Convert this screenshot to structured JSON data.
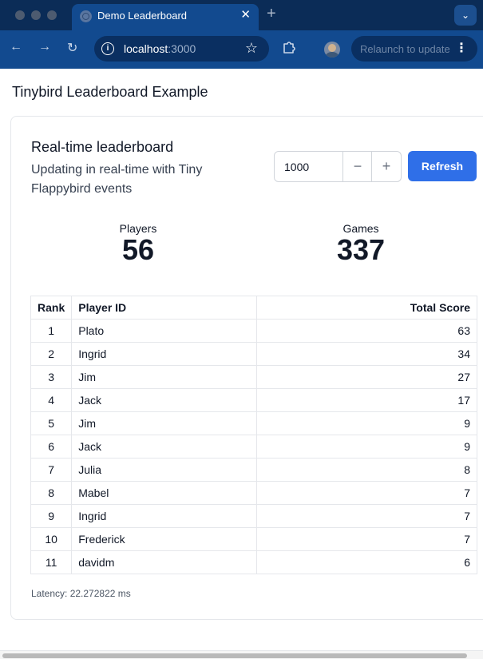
{
  "browser": {
    "tab_title": "Demo Leaderboard",
    "url_host": "localhost",
    "url_port": ":3000",
    "relaunch_label": "Relaunch to update"
  },
  "page": {
    "title": "Tinybird Leaderboard Example"
  },
  "card": {
    "title": "Real-time leaderboard",
    "subtitle": "Updating in real-time with Tiny Flappybird events",
    "limit_value": "1000",
    "decrement_label": "−",
    "increment_label": "+",
    "refresh_label": "Refresh"
  },
  "stats": {
    "players_label": "Players",
    "players_value": "56",
    "games_label": "Games",
    "games_value": "337"
  },
  "table": {
    "headers": {
      "rank": "Rank",
      "player": "Player ID",
      "score": "Total Score"
    },
    "rows": [
      {
        "rank": "1",
        "player": "Plato",
        "score": "63"
      },
      {
        "rank": "2",
        "player": "Ingrid",
        "score": "34"
      },
      {
        "rank": "3",
        "player": "Jim",
        "score": "27"
      },
      {
        "rank": "4",
        "player": "Jack",
        "score": "17"
      },
      {
        "rank": "5",
        "player": "Jim",
        "score": "9"
      },
      {
        "rank": "6",
        "player": "Jack",
        "score": "9"
      },
      {
        "rank": "7",
        "player": "Julia",
        "score": "8"
      },
      {
        "rank": "8",
        "player": "Mabel",
        "score": "7"
      },
      {
        "rank": "9",
        "player": "Ingrid",
        "score": "7"
      },
      {
        "rank": "10",
        "player": "Frederick",
        "score": "7"
      },
      {
        "rank": "11",
        "player": "davidm",
        "score": "6"
      }
    ]
  },
  "latency": "Latency: 22.272822 ms",
  "icons": {
    "back": "arrow-left-icon",
    "forward": "arrow-right-icon",
    "reload": "reload-icon",
    "site_info": "info-icon",
    "bookmark": "star-icon",
    "extensions": "puzzle-icon",
    "menu": "kebab-menu-icon"
  },
  "colors": {
    "tab_bar": "#0b2c57",
    "toolbar": "#124a8f",
    "primary_button": "#2f6fe8",
    "border": "#e5e7eb"
  }
}
